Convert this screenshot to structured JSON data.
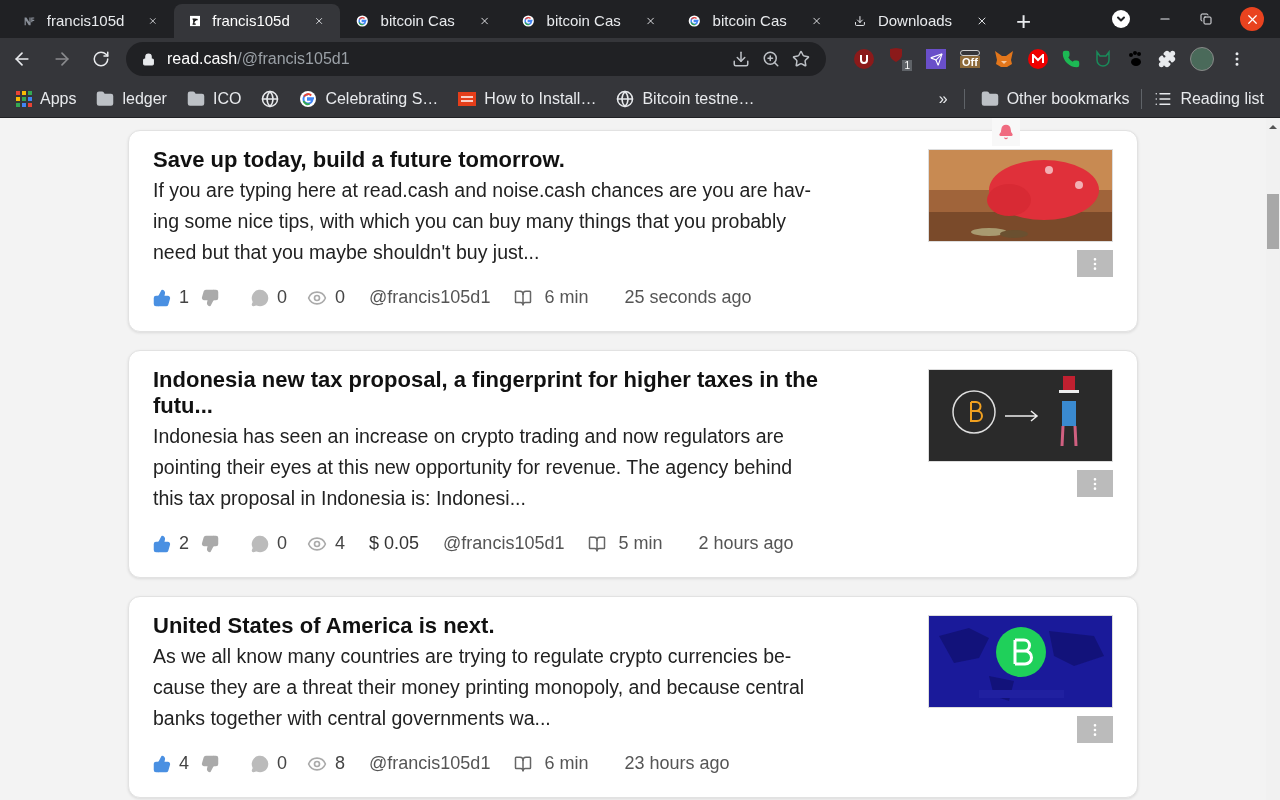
{
  "tabs": [
    {
      "title": "francis105d",
      "kind": "nf",
      "selected": false
    },
    {
      "title": "francis105d",
      "kind": "r",
      "selected": true
    },
    {
      "title": "bitcoin Cas",
      "kind": "google",
      "selected": false
    },
    {
      "title": "bitcoin Cas",
      "kind": "google",
      "selected": false
    },
    {
      "title": "bitcoin Cas",
      "kind": "google",
      "selected": false
    },
    {
      "title": "Downloads",
      "kind": "download",
      "selected": false
    }
  ],
  "new_tab": "+",
  "address": {
    "host": "read.cash",
    "path": "/@francis105d1"
  },
  "extensions": [
    {
      "kind": "shield"
    },
    {
      "kind": "shield-badge",
      "badge": "1"
    },
    {
      "kind": "paper-plane"
    },
    {
      "kind": "off",
      "label": "Off"
    },
    {
      "kind": "fox"
    },
    {
      "kind": "m"
    },
    {
      "kind": "phone"
    },
    {
      "kind": "cat"
    },
    {
      "kind": "foot"
    },
    {
      "kind": "puzzle"
    }
  ],
  "bookmarks": [
    {
      "kind": "apps",
      "label": "Apps"
    },
    {
      "kind": "folder",
      "label": "ledger"
    },
    {
      "kind": "folder",
      "label": "ICO"
    },
    {
      "kind": "globe"
    },
    {
      "kind": "google",
      "label": "Celebrating S…"
    },
    {
      "kind": "tcd",
      "label": "How to Install…"
    },
    {
      "kind": "globe",
      "label": "Bitcoin testne…"
    }
  ],
  "bookmarks_more": "»",
  "other_bookmarks": "Other bookmarks",
  "reading_list": "Reading list",
  "articles": [
    {
      "title_lines": [
        "Save up today, build a future tomorrow."
      ],
      "excerpt_lines": [
        "If you are typing here at read.cash and noise.cash chances are you are hav-",
        "ing some nice tips, with which you can buy many things that you probably",
        "need but that you maybe shouldn't buy just..."
      ],
      "likes": "1",
      "comments": "0",
      "views": "0",
      "author": "@francis105d1",
      "read_time": "6 min",
      "age": "25 seconds ago"
    },
    {
      "title_lines": [
        "Indonesia new tax proposal, a fingerprint for higher taxes in the",
        "futu..."
      ],
      "excerpt_lines": [
        "Indonesia has seen an increase on crypto trading and now regulators are",
        "pointing their eyes at this new opportunity for revenue. The agency behind",
        "this tax proposal in Indonesia is: Indonesi..."
      ],
      "likes": "2",
      "comments": "0",
      "views": "4",
      "earnings": "$ 0.05",
      "author": "@francis105d1",
      "read_time": "5 min",
      "age": "2 hours ago"
    },
    {
      "title_lines": [
        "United States of America is next."
      ],
      "excerpt_lines": [
        "As we all know many countries are trying to regulate crypto currencies be-",
        "cause they are a threat their money printing monopoly, and because central",
        "banks together with central governments wa..."
      ],
      "likes": "4",
      "comments": "0",
      "views": "8",
      "author": "@francis105d1",
      "read_time": "6 min",
      "age": "23 hours ago"
    }
  ]
}
